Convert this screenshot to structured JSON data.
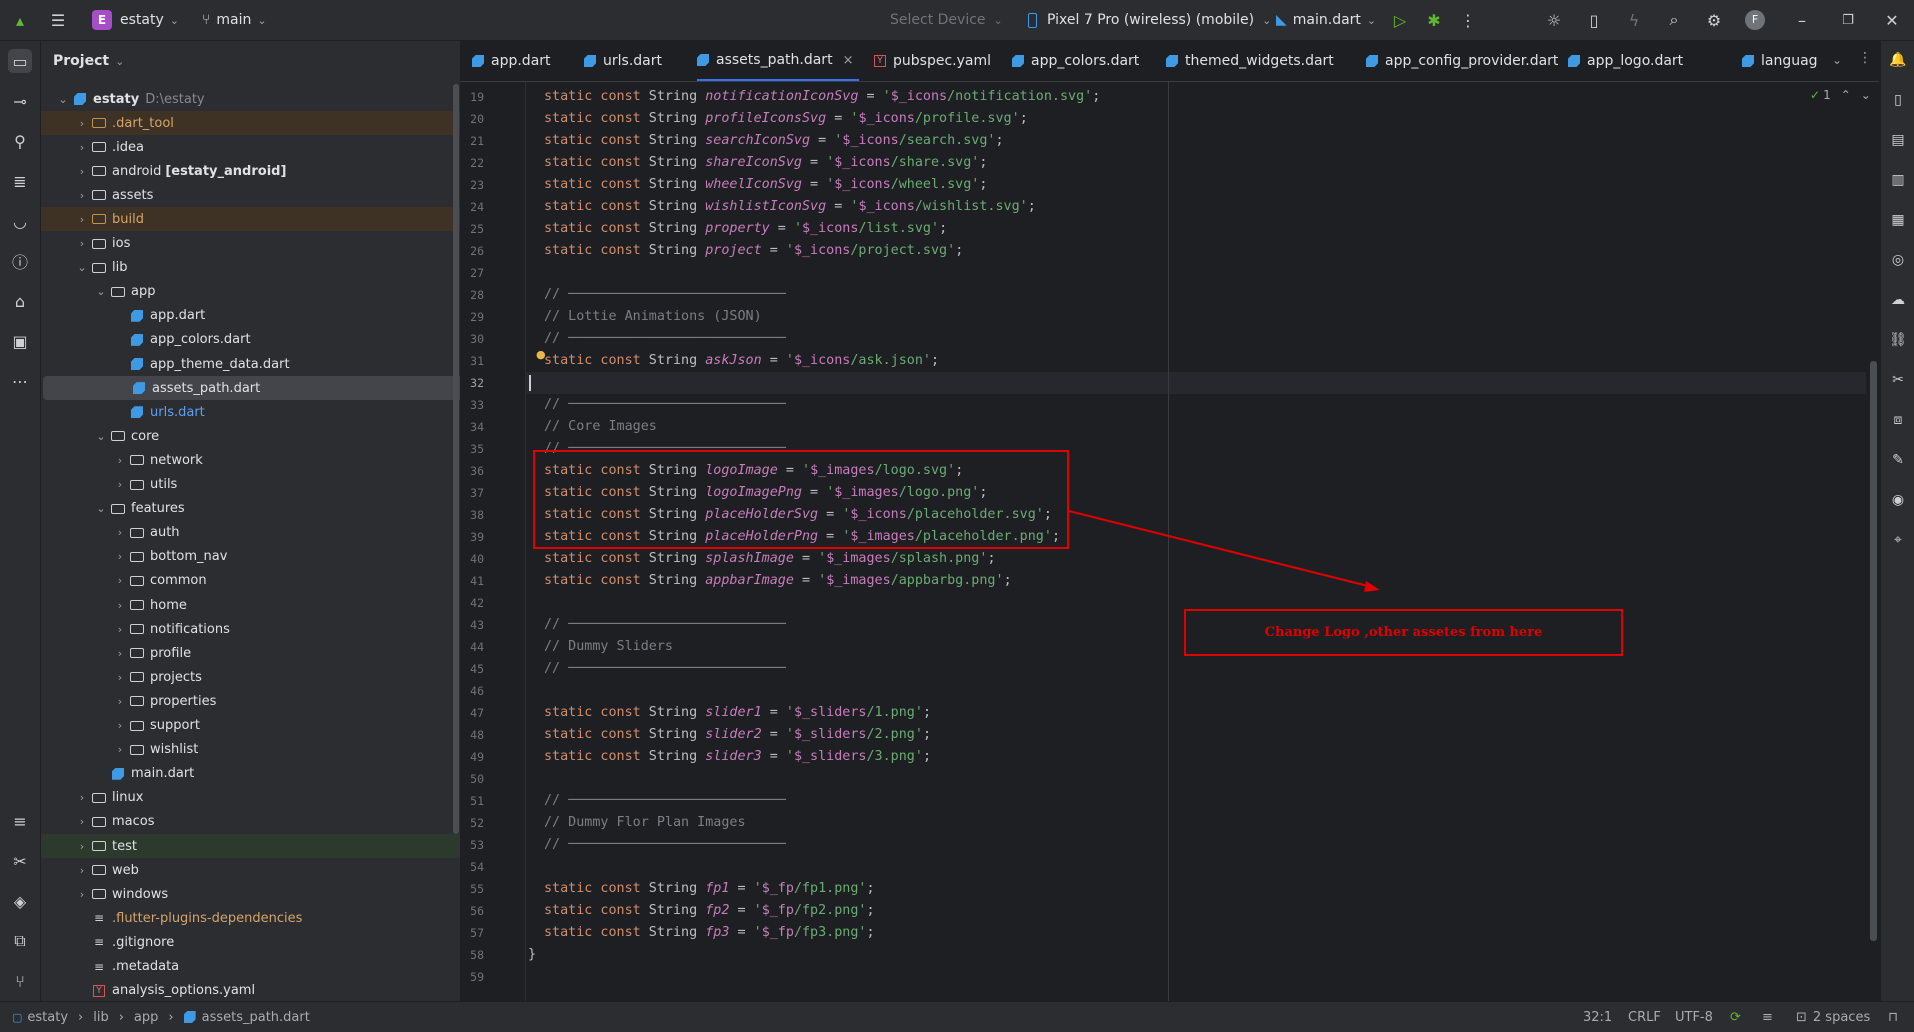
{
  "titlebar": {
    "project_letter": "E",
    "project_name": "estaty",
    "branch": "main",
    "device_placeholder": "Select Device",
    "device": "Pixel 7 Pro (wireless) (mobile)",
    "run_config": "main.dart",
    "avatar_letter": "F"
  },
  "project_panel": {
    "header": "Project",
    "root_name": "estaty",
    "root_path": "D:\\estaty",
    "items": [
      {
        "label": ".dart_tool",
        "kind": "folder"
      },
      {
        "label": ".idea",
        "kind": "folder"
      },
      {
        "label": "android",
        "suffix": "[estaty_android]",
        "kind": "folder"
      },
      {
        "label": "assets",
        "kind": "folder"
      },
      {
        "label": "build",
        "kind": "folder"
      },
      {
        "label": "ios",
        "kind": "folder"
      },
      {
        "label": "lib",
        "kind": "folder"
      },
      {
        "label": "app",
        "kind": "folder"
      },
      {
        "label": "app.dart",
        "kind": "dart"
      },
      {
        "label": "app_colors.dart",
        "kind": "dart"
      },
      {
        "label": "app_theme_data.dart",
        "kind": "dart"
      },
      {
        "label": "assets_path.dart",
        "kind": "dart"
      },
      {
        "label": "urls.dart",
        "kind": "dart"
      },
      {
        "label": "core",
        "kind": "folder"
      },
      {
        "label": "network",
        "kind": "folder"
      },
      {
        "label": "utils",
        "kind": "folder"
      },
      {
        "label": "features",
        "kind": "folder"
      },
      {
        "label": "auth",
        "kind": "folder"
      },
      {
        "label": "bottom_nav",
        "kind": "folder"
      },
      {
        "label": "common",
        "kind": "folder"
      },
      {
        "label": "home",
        "kind": "folder"
      },
      {
        "label": "notifications",
        "kind": "folder"
      },
      {
        "label": "profile",
        "kind": "folder"
      },
      {
        "label": "projects",
        "kind": "folder"
      },
      {
        "label": "properties",
        "kind": "folder"
      },
      {
        "label": "support",
        "kind": "folder"
      },
      {
        "label": "wishlist",
        "kind": "folder"
      },
      {
        "label": "main.dart",
        "kind": "dart"
      },
      {
        "label": "linux",
        "kind": "folder"
      },
      {
        "label": "macos",
        "kind": "folder"
      },
      {
        "label": "test",
        "kind": "folder"
      },
      {
        "label": "web",
        "kind": "folder"
      },
      {
        "label": "windows",
        "kind": "folder"
      },
      {
        "label": ".flutter-plugins-dependencies",
        "kind": "file"
      },
      {
        "label": ".gitignore",
        "kind": "file"
      },
      {
        "label": ".metadata",
        "kind": "file"
      },
      {
        "label": "analysis_options.yaml",
        "kind": "yaml"
      }
    ]
  },
  "tabs": [
    {
      "label": "app.dart",
      "kind": "dart"
    },
    {
      "label": "urls.dart",
      "kind": "dart"
    },
    {
      "label": "assets_path.dart",
      "kind": "dart",
      "active": true
    },
    {
      "label": "pubspec.yaml",
      "kind": "yaml"
    },
    {
      "label": "app_colors.dart",
      "kind": "dart"
    },
    {
      "label": "themed_widgets.dart",
      "kind": "dart"
    },
    {
      "label": "app_config_provider.dart",
      "kind": "dart"
    },
    {
      "label": "app_logo.dart",
      "kind": "dart"
    },
    {
      "label": "languag",
      "kind": "dart"
    }
  ],
  "inspection_count": "1",
  "code": {
    "first_line": 19,
    "current_line": 32,
    "lines": [
      "static const String notificationIconSvg = '$_icons/notification.svg';",
      "static const String profileIconsSvg = '$_icons/profile.svg';",
      "static const String searchIconSvg = '$_icons/search.svg';",
      "static const String shareIconSvg = '$_icons/share.svg';",
      "static const String wheelIconSvg = '$_icons/wheel.svg';",
      "static const String wishlistIconSvg = '$_icons/wishlist.svg';",
      "static const String property = '$_icons/list.svg';",
      "static const String project = '$_icons/project.svg';",
      "",
      "// ───────────────────────────",
      "// Lottie Animations (JSON)",
      "// ───────────────────────────",
      "static const String askJson = '$_icons/ask.json';",
      "",
      "// ───────────────────────────",
      "// Core Images",
      "// ───────────────────────────",
      "static const String logoImage = '$_images/logo.svg';",
      "static const String logoImagePng = '$_images/logo.png';",
      "static const String placeHolderSvg = '$_icons/placeholder.svg';",
      "static const String placeHolderPng = '$_images/placeholder.png';",
      "static const String splashImage = '$_images/splash.png';",
      "static const String appbarImage = '$_images/appbarbg.png';",
      "",
      "// ───────────────────────────",
      "// Dummy Sliders",
      "// ───────────────────────────",
      "",
      "static const String slider1 = '$_sliders/1.png';",
      "static const String slider2 = '$_sliders/2.png';",
      "static const String slider3 = '$_sliders/3.png';",
      "",
      "// ───────────────────────────",
      "// Dummy Flor Plan Images",
      "// ───────────────────────────",
      "",
      "static const String fp1 = '$_fp/fp1.png';",
      "static const String fp2 = '$_fp/fp2.png';",
      "static const String fp3 = '$_fp/fp3.png';",
      "}",
      ""
    ]
  },
  "annotation": {
    "text": "Change Logo ,other assetes from here",
    "color": "#e00000"
  },
  "statusbar": {
    "breadcrumb": [
      "estaty",
      "lib",
      "app",
      "assets_path.dart"
    ],
    "position": "32:1",
    "line_sep": "CRLF",
    "encoding": "UTF-8",
    "indent": "2 spaces"
  }
}
